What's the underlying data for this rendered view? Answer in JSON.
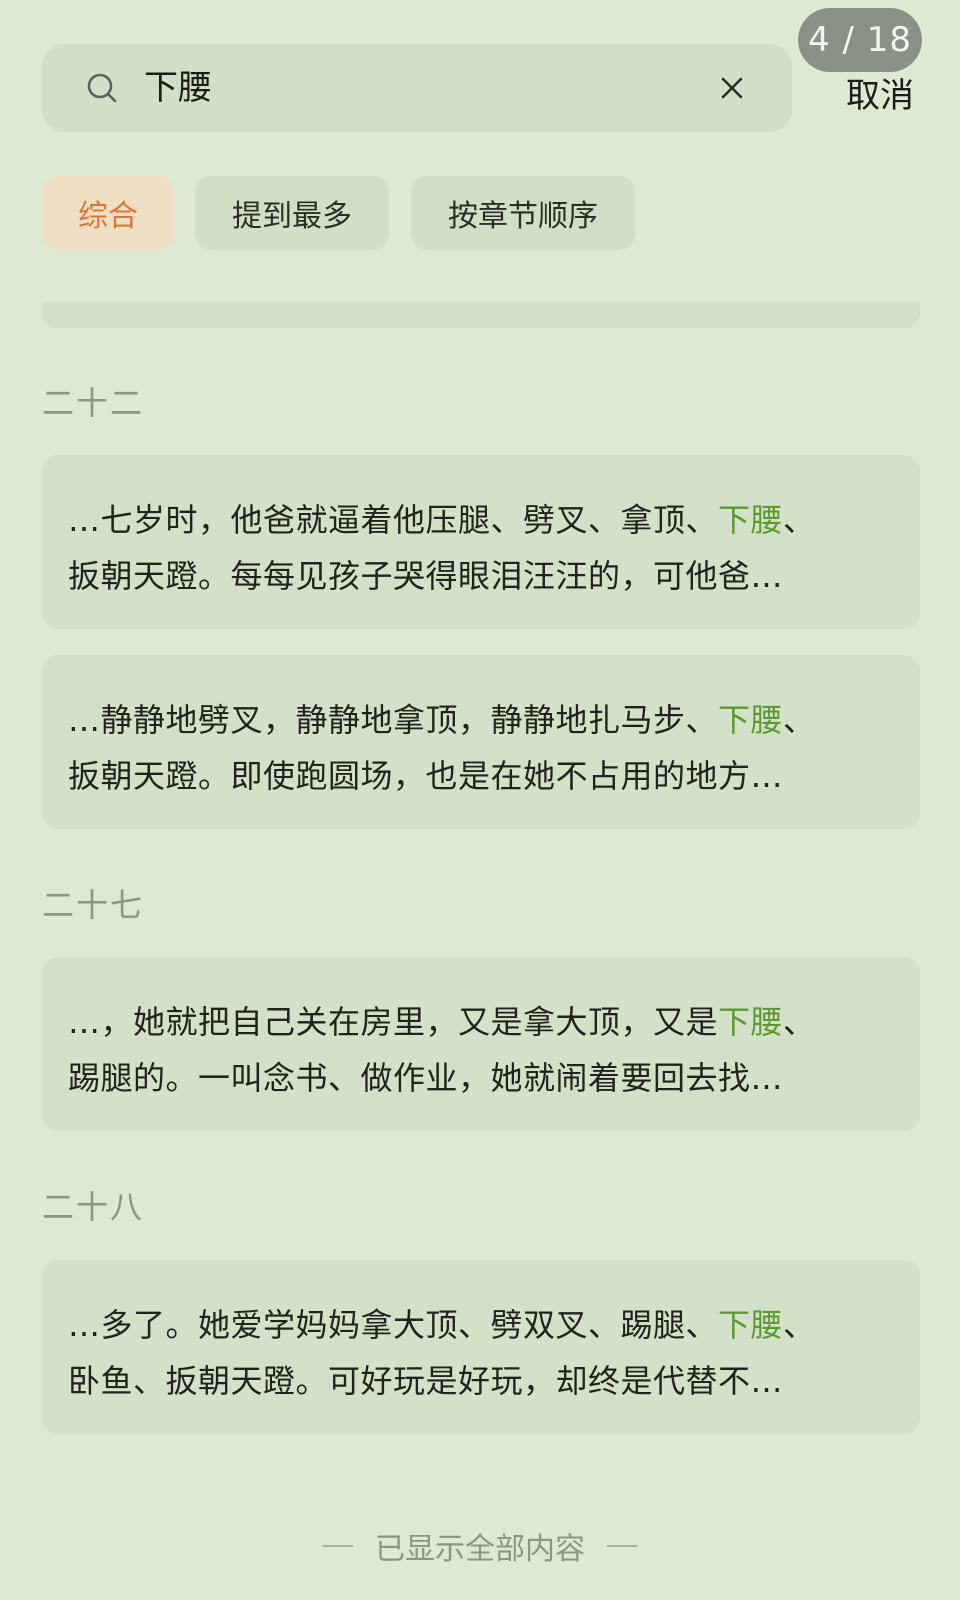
{
  "counter": "4 / 18",
  "search": {
    "query": "下腰",
    "cancel_label": "取消"
  },
  "tabs": [
    {
      "label": "综合",
      "active": true
    },
    {
      "label": "提到最多",
      "active": false
    },
    {
      "label": "按章节顺序",
      "active": false
    }
  ],
  "highlight_color": "#5e9a33",
  "groups": [
    {
      "chapter": "二十二",
      "results": [
        {
          "line1_before": "…七岁时，他爸就逼着他压腿、劈叉、拿顶、",
          "line1_match": "下腰",
          "line1_after": "、",
          "line2": "扳朝天蹬。每每见孩子哭得眼泪汪汪的，可他爸…"
        },
        {
          "line1_before": "…静静地劈叉，静静地拿顶，静静地扎马步、",
          "line1_match": "下腰",
          "line1_after": "、",
          "line2": "扳朝天蹬。即使跑圆场，也是在她不占用的地方…"
        }
      ]
    },
    {
      "chapter": "二十七",
      "results": [
        {
          "line1_before": "…，她就把自己关在房里，又是拿大顶，又是",
          "line1_match": "下腰",
          "line1_after": "、",
          "line2": "踢腿的。一叫念书、做作业，她就闹着要回去找…"
        }
      ]
    },
    {
      "chapter": "二十八",
      "results": [
        {
          "line1_before": "…多了。她爱学妈妈拿大顶、劈双叉、踢腿、",
          "line1_match": "下腰",
          "line1_after": "、",
          "line2": "卧鱼、扳朝天蹬。可好玩是好玩，却终是代替不…"
        }
      ]
    }
  ],
  "end_text": "已显示全部内容"
}
